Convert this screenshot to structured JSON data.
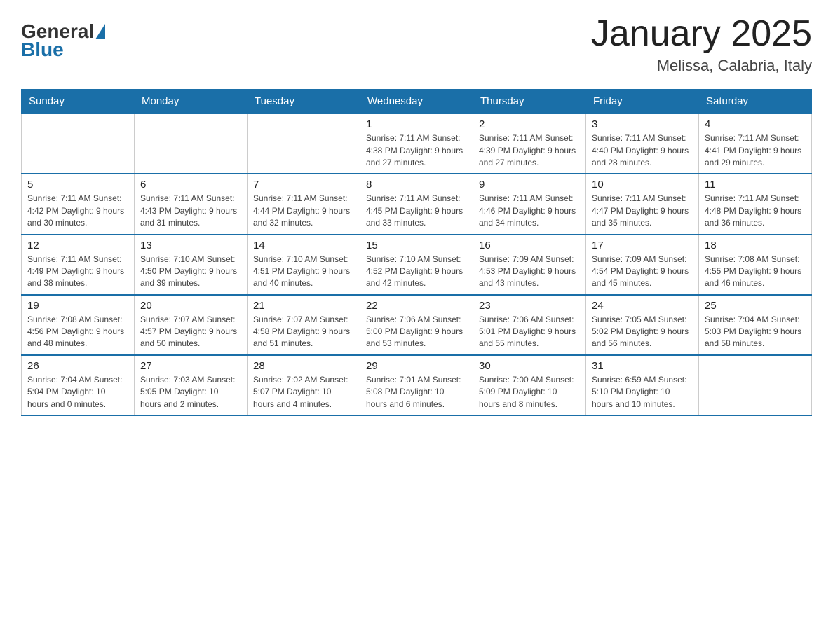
{
  "header": {
    "logo_general": "General",
    "logo_blue": "Blue",
    "title": "January 2025",
    "subtitle": "Melissa, Calabria, Italy"
  },
  "days_of_week": [
    "Sunday",
    "Monday",
    "Tuesday",
    "Wednesday",
    "Thursday",
    "Friday",
    "Saturday"
  ],
  "weeks": [
    [
      {
        "day": "",
        "info": ""
      },
      {
        "day": "",
        "info": ""
      },
      {
        "day": "",
        "info": ""
      },
      {
        "day": "1",
        "info": "Sunrise: 7:11 AM\nSunset: 4:38 PM\nDaylight: 9 hours\nand 27 minutes."
      },
      {
        "day": "2",
        "info": "Sunrise: 7:11 AM\nSunset: 4:39 PM\nDaylight: 9 hours\nand 27 minutes."
      },
      {
        "day": "3",
        "info": "Sunrise: 7:11 AM\nSunset: 4:40 PM\nDaylight: 9 hours\nand 28 minutes."
      },
      {
        "day": "4",
        "info": "Sunrise: 7:11 AM\nSunset: 4:41 PM\nDaylight: 9 hours\nand 29 minutes."
      }
    ],
    [
      {
        "day": "5",
        "info": "Sunrise: 7:11 AM\nSunset: 4:42 PM\nDaylight: 9 hours\nand 30 minutes."
      },
      {
        "day": "6",
        "info": "Sunrise: 7:11 AM\nSunset: 4:43 PM\nDaylight: 9 hours\nand 31 minutes."
      },
      {
        "day": "7",
        "info": "Sunrise: 7:11 AM\nSunset: 4:44 PM\nDaylight: 9 hours\nand 32 minutes."
      },
      {
        "day": "8",
        "info": "Sunrise: 7:11 AM\nSunset: 4:45 PM\nDaylight: 9 hours\nand 33 minutes."
      },
      {
        "day": "9",
        "info": "Sunrise: 7:11 AM\nSunset: 4:46 PM\nDaylight: 9 hours\nand 34 minutes."
      },
      {
        "day": "10",
        "info": "Sunrise: 7:11 AM\nSunset: 4:47 PM\nDaylight: 9 hours\nand 35 minutes."
      },
      {
        "day": "11",
        "info": "Sunrise: 7:11 AM\nSunset: 4:48 PM\nDaylight: 9 hours\nand 36 minutes."
      }
    ],
    [
      {
        "day": "12",
        "info": "Sunrise: 7:11 AM\nSunset: 4:49 PM\nDaylight: 9 hours\nand 38 minutes."
      },
      {
        "day": "13",
        "info": "Sunrise: 7:10 AM\nSunset: 4:50 PM\nDaylight: 9 hours\nand 39 minutes."
      },
      {
        "day": "14",
        "info": "Sunrise: 7:10 AM\nSunset: 4:51 PM\nDaylight: 9 hours\nand 40 minutes."
      },
      {
        "day": "15",
        "info": "Sunrise: 7:10 AM\nSunset: 4:52 PM\nDaylight: 9 hours\nand 42 minutes."
      },
      {
        "day": "16",
        "info": "Sunrise: 7:09 AM\nSunset: 4:53 PM\nDaylight: 9 hours\nand 43 minutes."
      },
      {
        "day": "17",
        "info": "Sunrise: 7:09 AM\nSunset: 4:54 PM\nDaylight: 9 hours\nand 45 minutes."
      },
      {
        "day": "18",
        "info": "Sunrise: 7:08 AM\nSunset: 4:55 PM\nDaylight: 9 hours\nand 46 minutes."
      }
    ],
    [
      {
        "day": "19",
        "info": "Sunrise: 7:08 AM\nSunset: 4:56 PM\nDaylight: 9 hours\nand 48 minutes."
      },
      {
        "day": "20",
        "info": "Sunrise: 7:07 AM\nSunset: 4:57 PM\nDaylight: 9 hours\nand 50 minutes."
      },
      {
        "day": "21",
        "info": "Sunrise: 7:07 AM\nSunset: 4:58 PM\nDaylight: 9 hours\nand 51 minutes."
      },
      {
        "day": "22",
        "info": "Sunrise: 7:06 AM\nSunset: 5:00 PM\nDaylight: 9 hours\nand 53 minutes."
      },
      {
        "day": "23",
        "info": "Sunrise: 7:06 AM\nSunset: 5:01 PM\nDaylight: 9 hours\nand 55 minutes."
      },
      {
        "day": "24",
        "info": "Sunrise: 7:05 AM\nSunset: 5:02 PM\nDaylight: 9 hours\nand 56 minutes."
      },
      {
        "day": "25",
        "info": "Sunrise: 7:04 AM\nSunset: 5:03 PM\nDaylight: 9 hours\nand 58 minutes."
      }
    ],
    [
      {
        "day": "26",
        "info": "Sunrise: 7:04 AM\nSunset: 5:04 PM\nDaylight: 10 hours\nand 0 minutes."
      },
      {
        "day": "27",
        "info": "Sunrise: 7:03 AM\nSunset: 5:05 PM\nDaylight: 10 hours\nand 2 minutes."
      },
      {
        "day": "28",
        "info": "Sunrise: 7:02 AM\nSunset: 5:07 PM\nDaylight: 10 hours\nand 4 minutes."
      },
      {
        "day": "29",
        "info": "Sunrise: 7:01 AM\nSunset: 5:08 PM\nDaylight: 10 hours\nand 6 minutes."
      },
      {
        "day": "30",
        "info": "Sunrise: 7:00 AM\nSunset: 5:09 PM\nDaylight: 10 hours\nand 8 minutes."
      },
      {
        "day": "31",
        "info": "Sunrise: 6:59 AM\nSunset: 5:10 PM\nDaylight: 10 hours\nand 10 minutes."
      },
      {
        "day": "",
        "info": ""
      }
    ]
  ]
}
